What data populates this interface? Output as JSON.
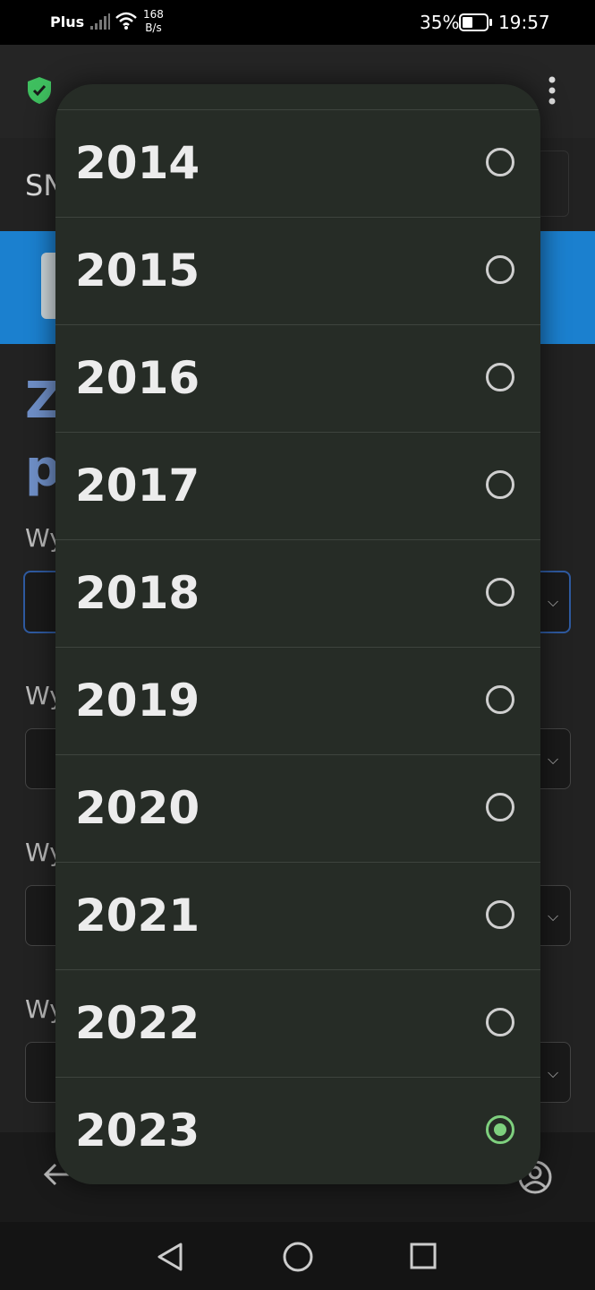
{
  "status_bar": {
    "carrier": "Plus",
    "speed_value": "168",
    "speed_unit": "B/s",
    "battery_percent": "35%",
    "time": "19:57"
  },
  "page": {
    "header_text": "SN",
    "title_line1": "Z",
    "title_line2": "p",
    "field_label_prefix": "Wy"
  },
  "dropdown": {
    "options": [
      {
        "label": "2014",
        "selected": false
      },
      {
        "label": "2015",
        "selected": false
      },
      {
        "label": "2016",
        "selected": false
      },
      {
        "label": "2017",
        "selected": false
      },
      {
        "label": "2018",
        "selected": false
      },
      {
        "label": "2019",
        "selected": false
      },
      {
        "label": "2020",
        "selected": false
      },
      {
        "label": "2021",
        "selected": false
      },
      {
        "label": "2022",
        "selected": false
      },
      {
        "label": "2023",
        "selected": true
      }
    ]
  },
  "colors": {
    "accent": "#7ed07e",
    "dialog_bg": "#262c26",
    "blue_band": "#1b80cf",
    "shield": "#3fbf5f"
  }
}
